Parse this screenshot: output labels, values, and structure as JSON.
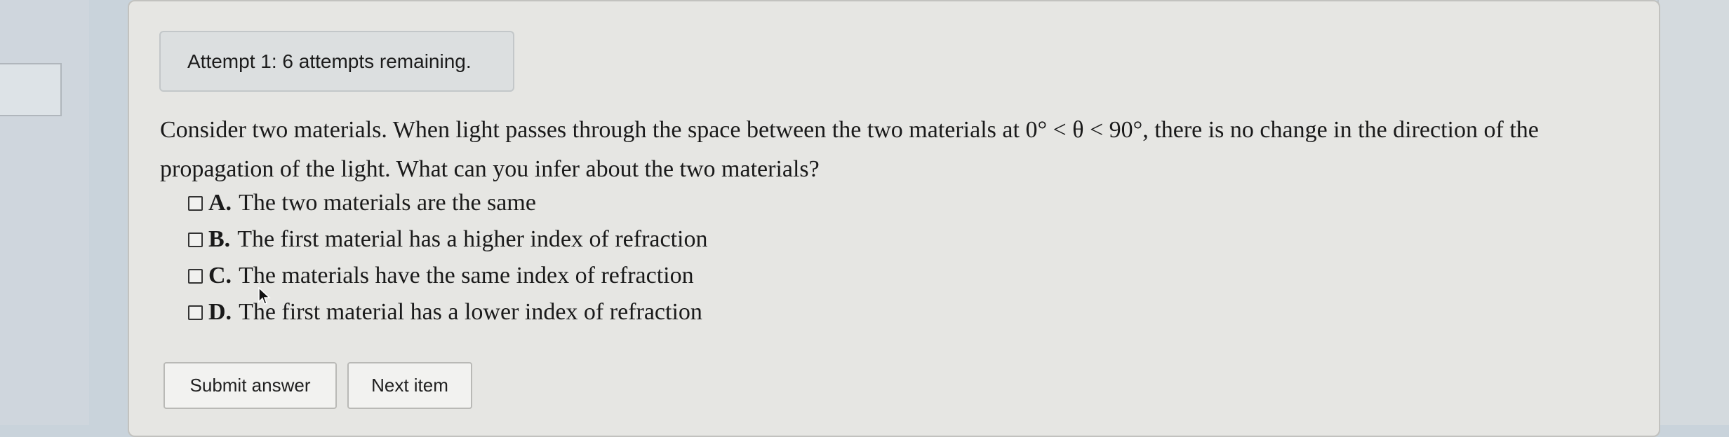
{
  "attempt": {
    "status_text": "Attempt 1: 6 attempts remaining."
  },
  "question": {
    "text_before_math": "Consider two materials. When light passes through the space between the two materials at ",
    "math": "0° < θ < 90°",
    "text_after_math": ", there is no change in the direction of the propagation of the light. What can you infer about the two materials?"
  },
  "choices": [
    {
      "letter": "A.",
      "text": "The two materials are the same"
    },
    {
      "letter": "B.",
      "text": "The first material has a higher index of refraction"
    },
    {
      "letter": "C.",
      "text": "The materials have the same index of refraction"
    },
    {
      "letter": "D.",
      "text": "The first material has a lower index of refraction"
    }
  ],
  "buttons": {
    "submit_label": "Submit answer",
    "next_label": "Next item"
  },
  "icons": {
    "cursor": "mouse-pointer-icon",
    "checkbox": "checkbox-icon"
  },
  "colors": {
    "panel_background": "#e6e6e3",
    "attempt_box_background": "#dcdfe0",
    "button_background": "#f2f2f0"
  }
}
